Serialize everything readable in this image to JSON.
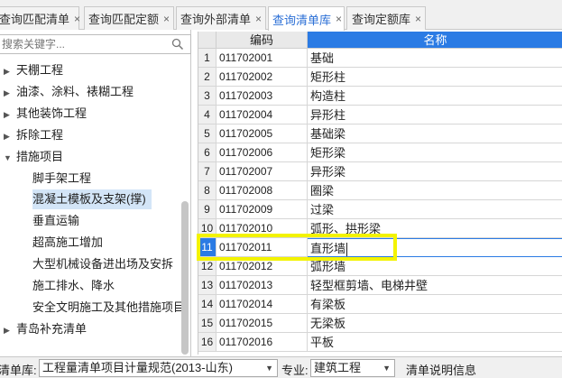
{
  "tabs": [
    {
      "label": "查询匹配清单",
      "active": false
    },
    {
      "label": "查询匹配定额",
      "active": false
    },
    {
      "label": "查询外部清单",
      "active": false
    },
    {
      "label": "查询清单库",
      "active": true
    },
    {
      "label": "查询定额库",
      "active": false
    }
  ],
  "tab_close_glyph": "×",
  "search": {
    "placeholder": "搜索关键字..."
  },
  "tree": [
    {
      "label": "天棚工程",
      "expanded": false,
      "child": false
    },
    {
      "label": "油漆、涂料、裱糊工程",
      "expanded": false,
      "child": false
    },
    {
      "label": "其他装饰工程",
      "expanded": false,
      "child": false
    },
    {
      "label": "拆除工程",
      "expanded": false,
      "child": false
    },
    {
      "label": "措施项目",
      "expanded": true,
      "child": false
    },
    {
      "label": "脚手架工程",
      "child": true
    },
    {
      "label": "混凝土模板及支架(撑)",
      "child": true,
      "selected": true
    },
    {
      "label": "垂直运输",
      "child": true
    },
    {
      "label": "超高施工增加",
      "child": true
    },
    {
      "label": "大型机械设备进出场及安拆",
      "child": true
    },
    {
      "label": "施工排水、降水",
      "child": true
    },
    {
      "label": "安全文明施工及其他措施项目",
      "child": true
    },
    {
      "label": "青岛补充清单",
      "expanded": false,
      "child": false
    }
  ],
  "grid": {
    "headers": {
      "code": "编码",
      "name": "名称"
    },
    "rows": [
      {
        "n": "1",
        "code": "011702001",
        "name": "基础"
      },
      {
        "n": "2",
        "code": "011702002",
        "name": "矩形柱"
      },
      {
        "n": "3",
        "code": "011702003",
        "name": "构造柱"
      },
      {
        "n": "4",
        "code": "011702004",
        "name": "异形柱"
      },
      {
        "n": "5",
        "code": "011702005",
        "name": "基础梁"
      },
      {
        "n": "6",
        "code": "011702006",
        "name": "矩形梁"
      },
      {
        "n": "7",
        "code": "011702007",
        "name": "异形梁"
      },
      {
        "n": "8",
        "code": "011702008",
        "name": "圈梁"
      },
      {
        "n": "9",
        "code": "011702009",
        "name": "过梁"
      },
      {
        "n": "10",
        "code": "011702010",
        "name": "弧形、拱形梁"
      },
      {
        "n": "11",
        "code": "011702011",
        "name": "直形墙",
        "current": true
      },
      {
        "n": "12",
        "code": "011702012",
        "name": "弧形墙"
      },
      {
        "n": "13",
        "code": "011702013",
        "name": "轻型框剪墙、电梯井壁"
      },
      {
        "n": "14",
        "code": "011702014",
        "name": "有梁板"
      },
      {
        "n": "15",
        "code": "011702015",
        "name": "无梁板"
      },
      {
        "n": "16",
        "code": "011702016",
        "name": "平板"
      }
    ]
  },
  "bottom": {
    "library_label": "清单库:",
    "library_value": "工程量清单项目计量规范(2013-山东)",
    "major_label": "专业:",
    "major_value": "建筑工程",
    "info_label": "清单说明信息"
  },
  "colors": {
    "accent": "#2b7be4",
    "highlight_box": "#f3f300",
    "selected_tree": "#d3e5f7"
  }
}
